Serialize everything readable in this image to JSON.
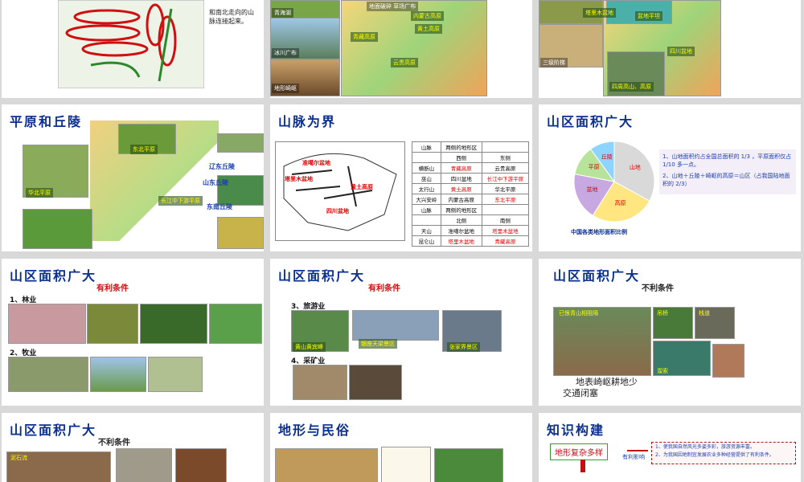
{
  "slides": {
    "s1": {
      "desc": "和南北走向的山脉连接起来。"
    },
    "s2": {
      "caps": [
        "内蒙古高原",
        "黄土高原",
        "云贵高原",
        "青藏高原",
        "地面破碎 草场广布",
        "青海湖",
        "冰川广布",
        "地形崎岖"
      ]
    },
    "s3": {
      "caps": [
        "四川盆地",
        "塔里木盆地",
        "三级阶梯",
        "盆地平坦",
        "四周高山、高原"
      ]
    },
    "s4": {
      "title": "平原和丘陵",
      "hills": [
        "辽东丘陵",
        "山东丘陵",
        "东南丘陵"
      ],
      "plains": [
        "东北平原",
        "华北平原",
        "长江中下游平原"
      ]
    },
    "s5": {
      "title": "山脉为界",
      "table": [
        [
          "山脉",
          "两侧的地形区",
          ""
        ],
        [
          "",
          "西侧",
          "东侧"
        ],
        [
          "横断山",
          "青藏高原",
          "云贵高原"
        ],
        [
          "巫山",
          "四川盆地",
          "长江中下游平原"
        ],
        [
          "太行山",
          "黄土高原",
          "华北平原"
        ],
        [
          "大兴安岭",
          "内蒙古高原",
          "东北平原"
        ],
        [
          "山脉",
          "两侧的地形区",
          ""
        ],
        [
          "",
          "北侧",
          "南侧"
        ],
        [
          "天山",
          "准噶尔盆地",
          "塔里木盆地"
        ],
        [
          "昆仑山",
          "塔里木盆地",
          "青藏高原"
        ]
      ],
      "map_labels": [
        "塔里木盆地",
        "准噶尔盆地",
        "四川盆地",
        "黄土高原"
      ]
    },
    "s6": {
      "title": "山区面积广大",
      "notes": [
        "1、山地面积约占全国总面积的 1/3 ，平原面积仅占 1/10 多一点。",
        "2、山地＋丘陵＋崎岖的高原＝山区（占我国陆地面积的 2/3）"
      ],
      "pie": [
        {
          "label": "山地",
          "value": 33,
          "color": "#d9d9d9"
        },
        {
          "label": "高原",
          "value": 26,
          "color": "#ffe680"
        },
        {
          "label": "盆地",
          "value": 19,
          "color": "#c8a8e0"
        },
        {
          "label": "平原",
          "value": 12,
          "color": "#b7e39a"
        },
        {
          "label": "丘陵",
          "value": 10,
          "color": "#8fd3ff"
        }
      ],
      "caption": "中国各类地形面积比例"
    },
    "s7": {
      "title": "山区面积广大",
      "sub": "有利条件",
      "items": [
        "1、林业",
        "2、牧业"
      ]
    },
    "s8": {
      "title": "山区面积广大",
      "sub": "有利条件",
      "items": [
        "3、旅游业",
        "4、采矿业"
      ],
      "caps": [
        "黄山黄宾峰",
        "银座天梁景区",
        "张家界景区"
      ]
    },
    "s9": {
      "title": "山区面积广大",
      "sub": "不利条件",
      "caps": [
        "已恨青山相阻隔",
        "吊桥",
        "栈道",
        "溜索"
      ],
      "lines": [
        "地表崎岖耕地少",
        "交通闭塞"
      ]
    },
    "s10": {
      "title": "山区面积广大",
      "sub": "不利条件",
      "caps": [
        "泥石流"
      ]
    },
    "s11": {
      "title": "地形与民俗"
    },
    "s12": {
      "title": "知识构建",
      "box": "地形复杂多样",
      "arrow": "有利影响",
      "points": [
        "1、使我国自然风光多姿多彩，旅游资源丰富。",
        "2、为我国因地制宜发展农业多种经营提供了有利条件。"
      ]
    }
  },
  "colors": {
    "title": "#0b2f8f",
    "accent": "#d01010"
  }
}
